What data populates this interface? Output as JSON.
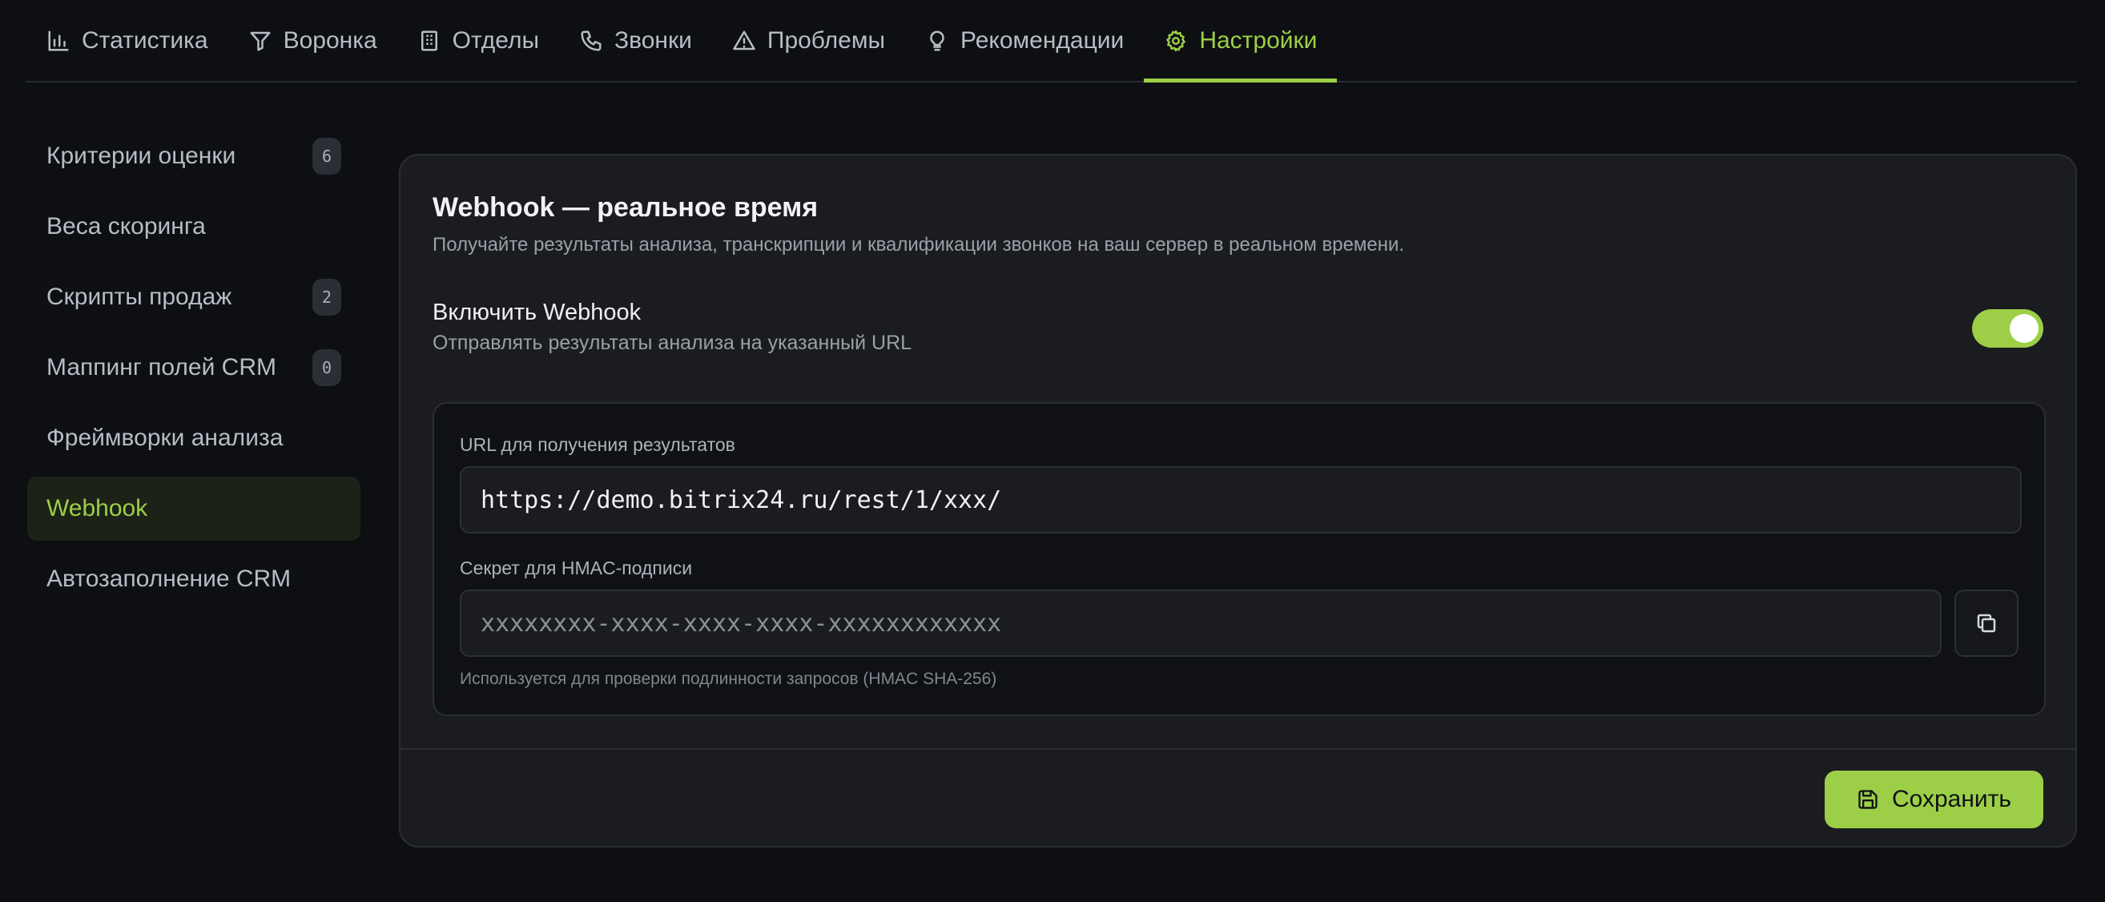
{
  "topnav": {
    "tabs": [
      {
        "label": "Статистика",
        "icon": "bar-chart-icon"
      },
      {
        "label": "Воронка",
        "icon": "funnel-icon"
      },
      {
        "label": "Отделы",
        "icon": "building-icon"
      },
      {
        "label": "Звонки",
        "icon": "phone-icon"
      },
      {
        "label": "Проблемы",
        "icon": "warning-triangle-icon"
      },
      {
        "label": "Рекомендации",
        "icon": "lightbulb-icon"
      },
      {
        "label": "Настройки",
        "icon": "gear-icon",
        "active": true
      }
    ]
  },
  "sidebar": {
    "items": [
      {
        "label": "Критерии оценки",
        "badge": "6"
      },
      {
        "label": "Веса скоринга"
      },
      {
        "label": "Скрипты продаж",
        "badge": "2"
      },
      {
        "label": "Маппинг полей CRM",
        "badge": "0"
      },
      {
        "label": "Фреймворки анализа"
      },
      {
        "label": "Webhook",
        "active": true
      },
      {
        "label": "Автозаполнение CRM"
      }
    ]
  },
  "card": {
    "title": "Webhook — реальное время",
    "subtitle": "Получайте результаты анализа, транскрипции и квалификации звонков на ваш сервер в реальном времени.",
    "toggle": {
      "label": "Включить Webhook",
      "description": "Отправлять результаты анализа на указанный URL",
      "enabled": true
    },
    "url_field": {
      "label": "URL для получения результатов",
      "value": "https://demo.bitrix24.ru/rest/1/xxx/"
    },
    "secret_field": {
      "label": "Секрет для HMAC-подписи",
      "placeholder": "xxxxxxxx-xxxx-xxxx-xxxx-xxxxxxxxxxxx",
      "hint": "Используется для проверки подлинности запросов (HMAC SHA-256)"
    },
    "save_label": "Сохранить"
  },
  "colors": {
    "accent": "#9ccf47",
    "background": "#0d0f13",
    "card": "#1b1c20"
  }
}
